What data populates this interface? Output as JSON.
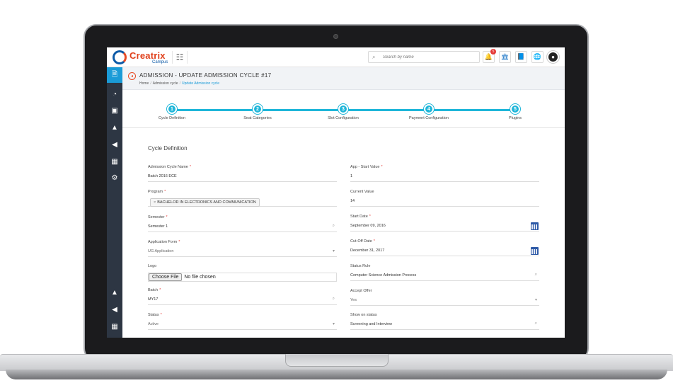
{
  "brand": {
    "name": "Creatrix",
    "sub": "Campus"
  },
  "search": {
    "placeholder": "Search by name"
  },
  "notifications": {
    "count": "5"
  },
  "header": {
    "title": "ADMISSION - UPDATE ADMISSION CYCLE #17",
    "breadcrumb": [
      "Home",
      "Admission cycle",
      "Update Admission cycle"
    ]
  },
  "steps": [
    {
      "num": "1",
      "label": "Cycle Definition"
    },
    {
      "num": "2",
      "label": "Seat Categories"
    },
    {
      "num": "3",
      "label": "Slot Configuration"
    },
    {
      "num": "4",
      "label": "Payment Configuration"
    },
    {
      "num": "5",
      "label": "Plugins"
    }
  ],
  "form": {
    "section_title": "Cycle Definition",
    "cycle_name": {
      "label": "Admission Cycle Name",
      "value": "Batch 2016 ECE"
    },
    "program": {
      "label": "Program",
      "chip": "BACHELOR IN ELECTRONICS AND COMMUNICATION"
    },
    "semester": {
      "label": "Semester",
      "value": "Semester 1"
    },
    "application_form": {
      "label": "Application Form",
      "value": "UG Application"
    },
    "logo": {
      "label": "Logo",
      "button": "Choose File",
      "status": "No file chosen"
    },
    "batch": {
      "label": "Batch",
      "value": "MY17"
    },
    "status": {
      "label": "Status",
      "value": "Active"
    },
    "app_start": {
      "label": "App - Start Value",
      "value": "1"
    },
    "current_value": {
      "label": "Current Value",
      "value": "14"
    },
    "start_date": {
      "label": "Start Date",
      "value": "September 09, 2016"
    },
    "cutoff_date": {
      "label": "Cut-Off Date",
      "value": "December 31, 2017"
    },
    "status_rule": {
      "label": "Status Rule",
      "value": "Computer Science Admission Process"
    },
    "accept_offer": {
      "label": "Accept Offer",
      "value": "Yes"
    },
    "show_on_status": {
      "label": "Show on status",
      "value": "Screening and Interview"
    }
  },
  "colors": {
    "accent": "#1fb6d9",
    "sidebar": "#2d3643",
    "brand_orange": "#e0401b",
    "brand_blue": "#0d5aa7"
  }
}
